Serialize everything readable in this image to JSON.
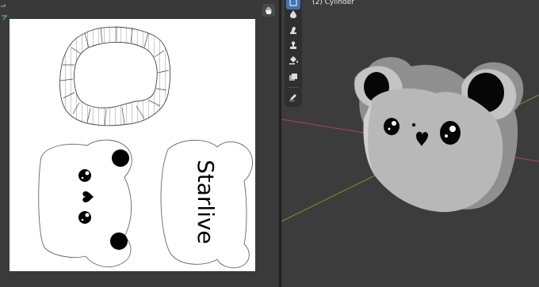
{
  "viewport": {
    "object_name": "(2) Cylinder"
  },
  "uv_editor": {
    "texture_text": "Starlive",
    "tools": {
      "hand": "hand-icon"
    }
  },
  "toolbar": {
    "tools": [
      {
        "name": "select-tool",
        "icon": "select-box-icon",
        "active": true
      },
      {
        "name": "draw-tool",
        "icon": "draw-drop-icon",
        "active": false
      },
      {
        "name": "soften-tool",
        "icon": "soften-icon",
        "active": false
      },
      {
        "name": "clone-tool",
        "icon": "clone-stamp-icon",
        "active": false
      },
      {
        "name": "fill-tool",
        "icon": "fill-bucket-icon",
        "active": false
      },
      {
        "name": "mask-tool",
        "icon": "mask-icon",
        "active": false
      },
      {
        "name": "annotate-tool",
        "icon": "annotate-pencil-icon",
        "active": false
      }
    ]
  },
  "colors": {
    "ui_background": "#3a3a3a",
    "accent_active": "#4772b3",
    "axis_x": "#b5424f",
    "axis_y": "#6d9c2c",
    "model_base": "#b8b8b8"
  }
}
